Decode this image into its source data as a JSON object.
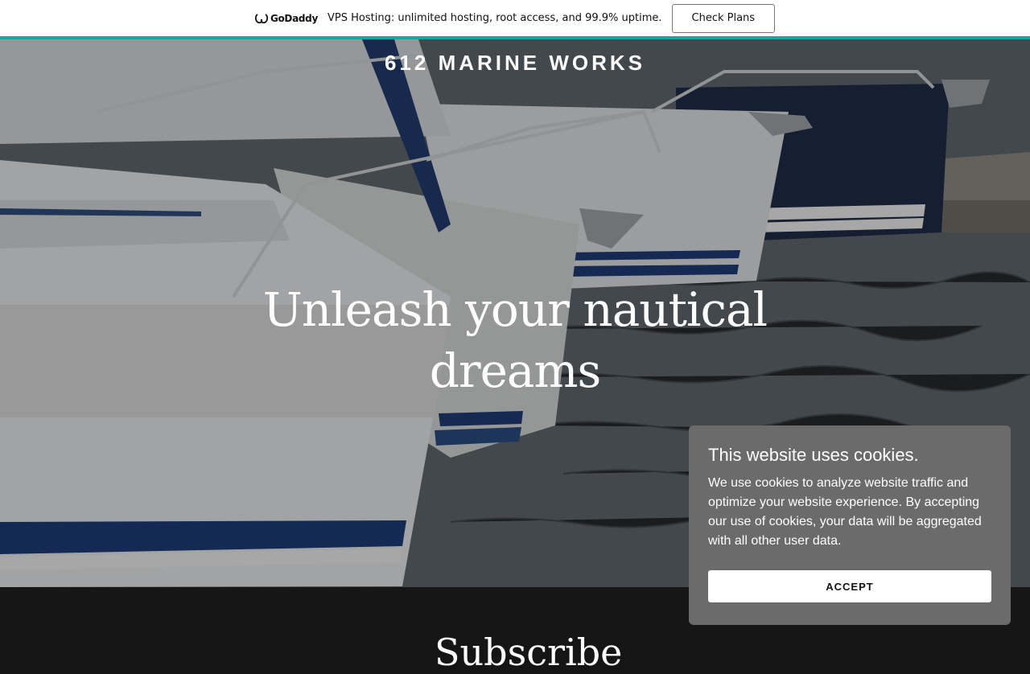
{
  "banner": {
    "logo_text": "GoDaddy",
    "promo_text": "VPS Hosting: unlimited hosting, root access, and 99.9% uptime.",
    "cta_label": "Check Plans",
    "accent_color": "#1ba5a5"
  },
  "hero": {
    "site_title": "612 MARINE WORKS",
    "headline": "Unleash your nautical dreams"
  },
  "next_section": {
    "heading": "Subscribe"
  },
  "cookie_dialog": {
    "title": "This website uses cookies.",
    "body": "We use cookies to analyze website traffic and optimize your website experience. By accepting our use of cookies, your data will be aggregated with all other user data.",
    "accept_label": "ACCEPT"
  }
}
